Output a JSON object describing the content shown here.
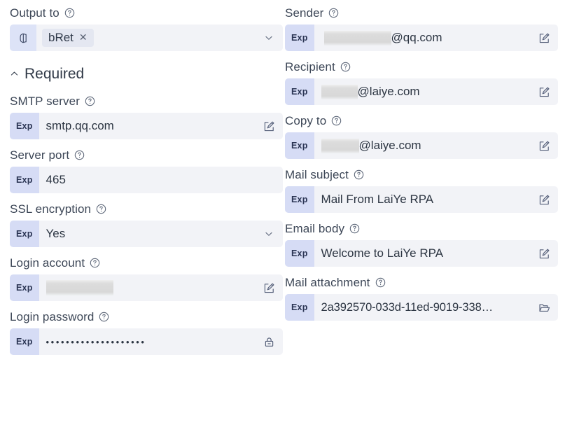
{
  "left_column": {
    "output_to": {
      "label": "Output to",
      "help_icon": "question-circle-icon",
      "variable_icon": "variable-brackets-icon",
      "chip_label": "bRet",
      "chip_close_icon": "close-icon",
      "dropdown_icon": "chevron-down-icon"
    },
    "section": {
      "label": "Required",
      "collapse_icon": "chevron-up-icon",
      "expanded": true
    },
    "fields": [
      {
        "label": "SMTP server",
        "help_icon": "question-circle-icon",
        "badge": "Exp",
        "value": "smtp.qq.com",
        "trailing_icon": "edit-pencil-icon",
        "redacted": false
      },
      {
        "label": "Server port",
        "help_icon": "question-circle-icon",
        "badge": "Exp",
        "value": "465",
        "trailing_icon": "none",
        "redacted": false
      },
      {
        "label": "SSL encryption",
        "help_icon": "question-circle-icon",
        "badge": "Exp",
        "value": "Yes",
        "trailing_icon": "chevron-down-icon",
        "redacted": false
      },
      {
        "label": "Login account",
        "help_icon": "question-circle-icon",
        "badge": "Exp",
        "value": "",
        "trailing_icon": "edit-pencil-icon",
        "redacted": true
      },
      {
        "label": "Login password",
        "help_icon": "question-circle-icon",
        "badge": "Exp",
        "value": "••••••••••••••••••••",
        "trailing_icon": "lock-icon",
        "redacted": false
      }
    ]
  },
  "right_column": {
    "fields": [
      {
        "label": "Sender",
        "help_icon": "question-circle-icon",
        "badge": "Exp",
        "value_prefix_redacted": true,
        "value": "@qq.com",
        "trailing_icon": "edit-pencil-icon"
      },
      {
        "label": "Recipient",
        "help_icon": "question-circle-icon",
        "badge": "Exp",
        "value_prefix_redacted": true,
        "value": "@laiye.com",
        "trailing_icon": "edit-pencil-icon"
      },
      {
        "label": "Copy to",
        "help_icon": "question-circle-icon",
        "badge": "Exp",
        "value_prefix_redacted": true,
        "value": "@laiye.com",
        "trailing_icon": "edit-pencil-icon"
      },
      {
        "label": "Mail subject",
        "help_icon": "question-circle-icon",
        "badge": "Exp",
        "value_prefix_redacted": false,
        "value": "Mail From LaiYe RPA",
        "trailing_icon": "edit-pencil-icon"
      },
      {
        "label": "Email body",
        "help_icon": "question-circle-icon",
        "badge": "Exp",
        "value_prefix_redacted": false,
        "value": "Welcome to LaiYe RPA",
        "trailing_icon": "edit-pencil-icon"
      },
      {
        "label": "Mail attachment",
        "help_icon": "question-circle-icon",
        "badge": "Exp",
        "value_prefix_redacted": false,
        "value": "2a392570-033d-11ed-9019-338…",
        "trailing_icon": "folder-open-icon"
      }
    ]
  },
  "colors": {
    "input_background": "#f2f3f7",
    "badge_background": "#d6dcf5",
    "badge_text": "#2b3554",
    "label_text": "#3d4757",
    "value_text": "#2c3542",
    "chip_background": "#e4e7f1",
    "redaction": "#d9d9d9",
    "page_background": "#ffffff"
  }
}
